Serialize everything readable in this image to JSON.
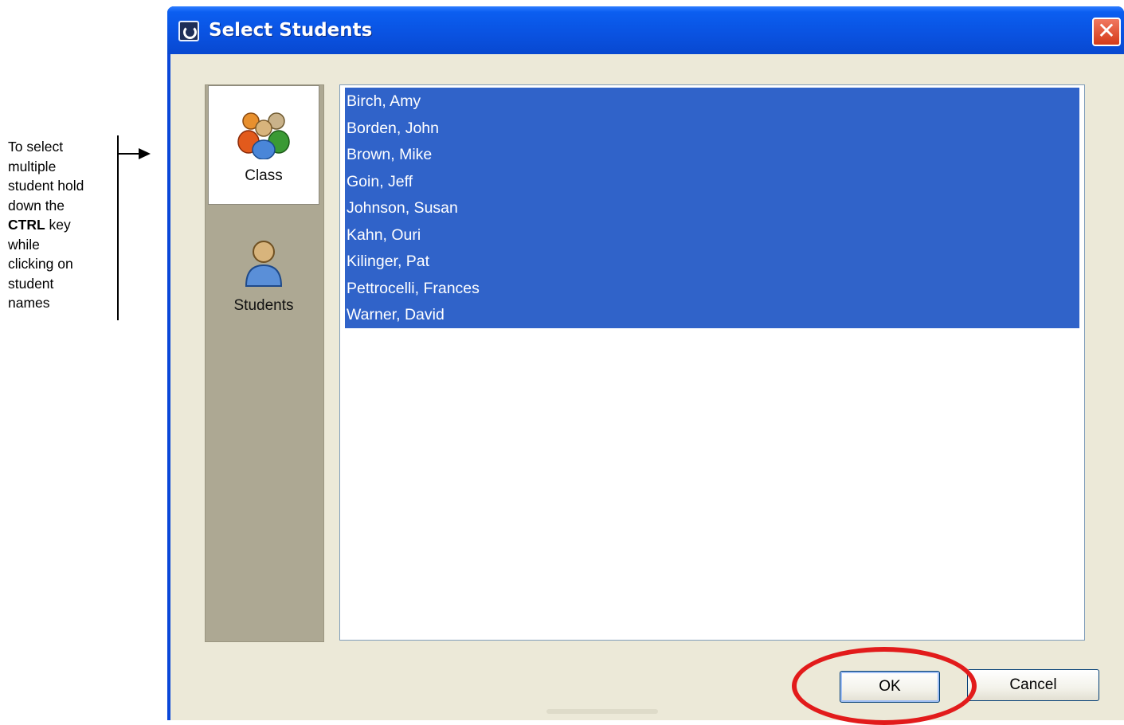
{
  "annotation": {
    "lines": [
      "To select",
      "multiple",
      "student hold",
      "down the"
    ],
    "key_name": "CTRL",
    "key_suffix": " key",
    "tail_lines": [
      "while",
      "clicking on",
      "student",
      "names"
    ]
  },
  "window": {
    "title": "Select Students",
    "close_glyph": "✕"
  },
  "sidenav": {
    "items": [
      {
        "label": "Class",
        "icon": "group-icon",
        "active": true
      },
      {
        "label": "Students",
        "icon": "person-icon",
        "active": false
      }
    ]
  },
  "students": [
    "Birch, Amy",
    "Borden, John",
    "Brown, Mike",
    "Goin, Jeff",
    "Johnson, Susan",
    "Kahn, Ouri",
    "Kilinger, Pat",
    "Pettrocelli, Frances",
    "Warner, David"
  ],
  "selection_color": "#3063c9",
  "buttons": {
    "ok": "OK",
    "cancel": "Cancel"
  },
  "highlight_color": "#e21b1b"
}
